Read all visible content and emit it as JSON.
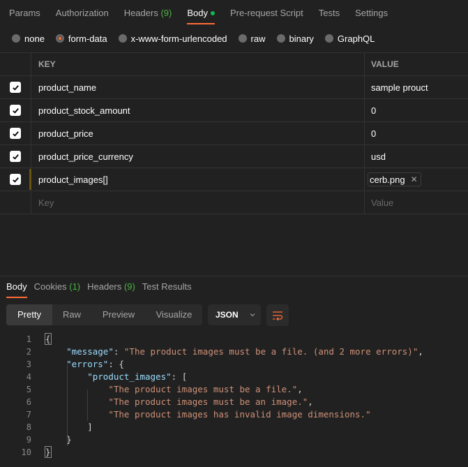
{
  "request_tabs": [
    {
      "label": "Params"
    },
    {
      "label": "Authorization"
    },
    {
      "label": "Headers",
      "count": "(9)"
    },
    {
      "label": "Body",
      "active": true,
      "indicator": "green-dot"
    },
    {
      "label": "Pre-request Script"
    },
    {
      "label": "Tests"
    },
    {
      "label": "Settings"
    }
  ],
  "body_types": [
    {
      "label": "none",
      "checked": false
    },
    {
      "label": "form-data",
      "checked": true
    },
    {
      "label": "x-www-form-urlencoded",
      "checked": false
    },
    {
      "label": "raw",
      "checked": false
    },
    {
      "label": "binary",
      "checked": false
    },
    {
      "label": "GraphQL",
      "checked": false
    }
  ],
  "table": {
    "headers": {
      "key": "KEY",
      "value": "VALUE"
    },
    "rows": [
      {
        "checked": true,
        "key": "product_name",
        "value": "sample prouct"
      },
      {
        "checked": true,
        "key": "product_stock_amount",
        "value": "0"
      },
      {
        "checked": true,
        "key": "product_price",
        "value": "0"
      },
      {
        "checked": true,
        "key": "product_price_currency",
        "value": "usd"
      },
      {
        "checked": true,
        "key": "product_images[]",
        "file": "cerb.png"
      }
    ],
    "new_row": {
      "key_placeholder": "Key",
      "value_placeholder": "Value"
    }
  },
  "response_tabs": [
    {
      "label": "Body",
      "active": true
    },
    {
      "label": "Cookies",
      "count": "(1)"
    },
    {
      "label": "Headers",
      "count": "(9)"
    },
    {
      "label": "Test Results"
    }
  ],
  "view_modes": [
    "Pretty",
    "Raw",
    "Preview",
    "Visualize"
  ],
  "active_view": "Pretty",
  "format": "JSON",
  "icons": {
    "wrap": "wrap-lines-icon",
    "chevron": "chevron-down-icon",
    "check": "checkmark-icon",
    "remove": "close-icon"
  },
  "colors": {
    "accent": "#ff6c37",
    "count": "#4bb543",
    "json_key": "#9cdcfe",
    "json_string": "#ce9178"
  },
  "code": {
    "line_numbers": [
      "1",
      "2",
      "3",
      "4",
      "5",
      "6",
      "7",
      "8",
      "9",
      "10"
    ],
    "message_key": "\"message\"",
    "message_value": "\"The product images must be a file. (and 2 more errors)\"",
    "errors_key": "\"errors\"",
    "product_images_key": "\"product_images\"",
    "errors": [
      "\"The product images must be a file.\"",
      "\"The product images must be an image.\"",
      "\"The product images has invalid image dimensions.\""
    ]
  }
}
